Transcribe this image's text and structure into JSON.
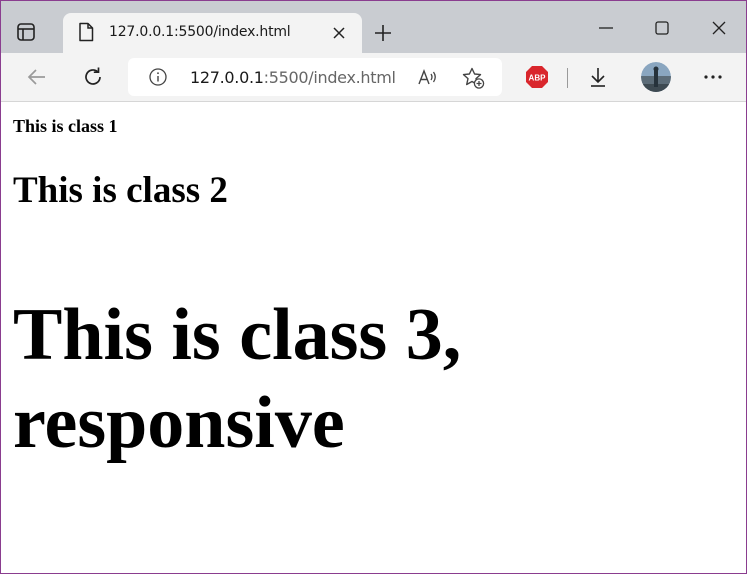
{
  "browser": {
    "tab": {
      "title": "127.0.0.1:5500/index.html"
    },
    "address": {
      "host": "127.0.0.1",
      "rest": ":5500/index.html"
    },
    "icons": {
      "tab_actions": "tab-actions-icon",
      "favicon": "document-icon",
      "close_tab": "close-icon",
      "new_tab": "plus-icon",
      "minimize": "minimize-icon",
      "maximize": "maximize-icon",
      "close_window": "close-icon",
      "back": "back-arrow-icon",
      "reload": "reload-icon",
      "site_info": "info-icon",
      "read_aloud": "read-aloud-icon",
      "favorites": "add-favorite-icon",
      "adblock": "adblock-plus-icon",
      "downloads": "download-icon",
      "profile": "avatar",
      "more": "more-options-icon"
    },
    "colors": {
      "tabstrip": "#c9ccd1",
      "toolbar": "#f3f3f3",
      "abp_red": "#d9262c",
      "frame": "#8a3d8f"
    }
  },
  "page": {
    "class1": "This is class 1",
    "class2": "This is class 2",
    "class3": "This is class 3, responsive"
  }
}
